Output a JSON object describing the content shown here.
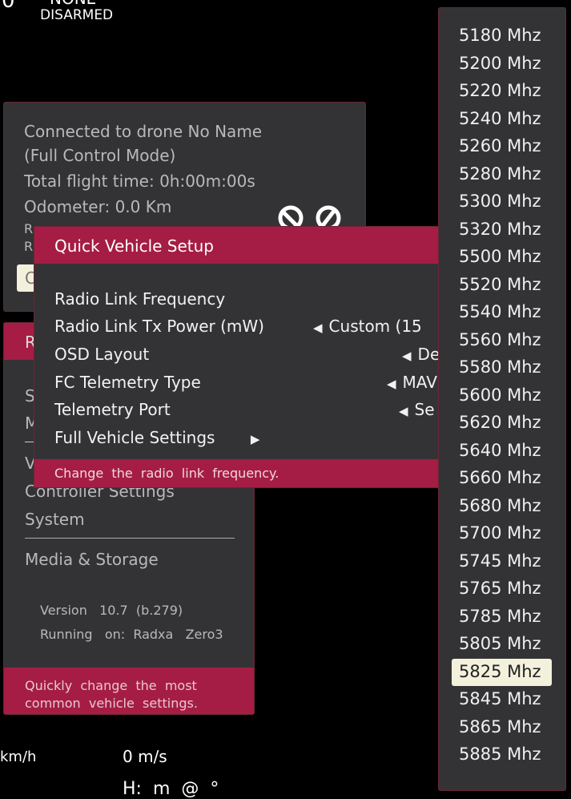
{
  "hud": {
    "top_number": "0",
    "top_mode": "NONE",
    "armed_status": "DISARMED",
    "speed_left": "km/h",
    "speed_vertical": "0 m/s",
    "bottom_text": "H:  m  @  °"
  },
  "drone_panel": {
    "line1": "Connected  to  drone  No  Name",
    "line2": "(Full  Control  Mode)",
    "line3": "Total  flight  time: 0h:00m:00s",
    "line4": "Odometer:  0.0  Km",
    "line5_partial": "R",
    "line6_partial": "R",
    "button_partial": "C"
  },
  "settings_panel": {
    "header_partial": "R",
    "item_s": "S",
    "item_m": "M",
    "item_v": "V",
    "controller_settings": "Controller Settings",
    "system": "System",
    "media_storage": "Media & Storage",
    "version": "Version   10.7  (b.279)",
    "running": "Running   on:  Radxa   Zero3",
    "footer": "Quickly  change  the  most  common  vehicle  settings."
  },
  "quick_setup": {
    "title": "Quick Vehicle Setup",
    "items": [
      {
        "label": "Radio Link Frequency",
        "value": ""
      },
      {
        "label": "Radio Link Tx Power (mW)",
        "value": "Custom (15"
      },
      {
        "label": "OSD Layout",
        "value": "De"
      },
      {
        "label": "FC Telemetry Type",
        "value": "MAV"
      },
      {
        "label": "Telemetry Port",
        "value": "Se"
      },
      {
        "label": "Full Vehicle Settings",
        "value": ""
      }
    ],
    "footer": "Change  the  radio  link  frequency."
  },
  "frequency_list": {
    "items": [
      "5180 Mhz",
      "5200 Mhz",
      "5220 Mhz",
      "5240 Mhz",
      "5260 Mhz",
      "5280 Mhz",
      "5300 Mhz",
      "5320 Mhz",
      "5500 Mhz",
      "5520 Mhz",
      "5540 Mhz",
      "5560 Mhz",
      "5580 Mhz",
      "5600 Mhz",
      "5620 Mhz",
      "5640 Mhz",
      "5660 Mhz",
      "5680 Mhz",
      "5700 Mhz",
      "5745 Mhz",
      "5765 Mhz",
      "5785 Mhz",
      "5805 Mhz",
      "5825 Mhz",
      "5845 Mhz",
      "5865 Mhz",
      "5885 Mhz"
    ],
    "selected": "5825 Mhz"
  },
  "colors": {
    "accent": "#a51d44",
    "panel": "#333335",
    "selection": "#f3f0dc"
  }
}
